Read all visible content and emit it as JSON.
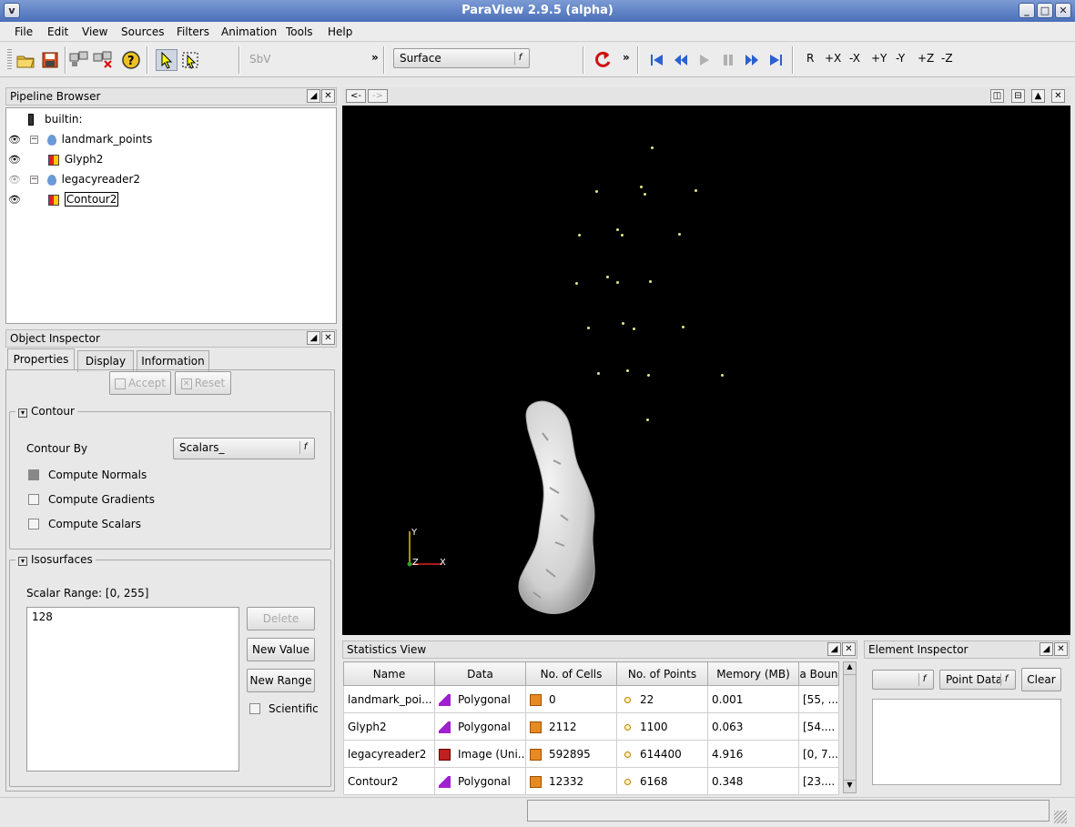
{
  "window": {
    "title": "ParaView 2.9.5 (alpha)"
  },
  "menu": [
    "File",
    "Edit",
    "View",
    "Sources",
    "Filters",
    "Animation",
    "Tools",
    "Help"
  ],
  "toolbar": {
    "calc_label": "SbV",
    "more_label": "»",
    "representation": "Surface",
    "camera_buttons": [
      "R",
      "+X",
      "-X",
      "+Y",
      "-Y",
      "+Z",
      "-Z"
    ]
  },
  "pipeline": {
    "title": "Pipeline Browser",
    "items": [
      {
        "label": "builtin:",
        "icon": "server-icon"
      },
      {
        "label": "landmark_points",
        "icon": "source-icon"
      },
      {
        "label": "Glyph2",
        "icon": "filter-icon"
      },
      {
        "label": "legacyreader2",
        "icon": "source-icon"
      },
      {
        "label": "Contour2",
        "icon": "filter-icon"
      }
    ]
  },
  "view_nav": {
    "back": "<-",
    "forward": "->"
  },
  "inspector": {
    "title": "Object Inspector",
    "tabs": [
      "Properties",
      "Display",
      "Information"
    ],
    "accept": "Accept",
    "reset": "Reset",
    "contour_group": "Contour",
    "contour_by_label": "Contour By",
    "contour_by_value": "Scalars_",
    "checks": [
      "Compute Normals",
      "Compute Gradients",
      "Compute Scalars"
    ],
    "iso_group": "Isosurfaces",
    "scalar_range": "Scalar Range: [0, 255]",
    "values": [
      "128"
    ],
    "delete": "Delete",
    "new_value": "New Value",
    "new_range": "New Range",
    "scientific": "Scientific"
  },
  "axes": {
    "y": "Y",
    "z": "Z",
    "x": "X"
  },
  "stats": {
    "title": "Statistics View",
    "columns": [
      "Name",
      "Data",
      "No. of Cells",
      "No. of Points",
      "Memory (MB)",
      "a Boun"
    ],
    "rows": [
      {
        "name": "landmark_poi...",
        "data": "Polygonal",
        "cells": "0",
        "points": "22",
        "memory": "0.001",
        "bounds": "[55, ..."
      },
      {
        "name": "Glyph2",
        "data": "Polygonal",
        "cells": "2112",
        "points": "1100",
        "memory": "0.063",
        "bounds": "[54...."
      },
      {
        "name": "legacyreader2",
        "data": "Image (Uni...",
        "cells": "592895",
        "points": "614400",
        "memory": "4.916",
        "bounds": "[0, 7..."
      },
      {
        "name": "Contour2",
        "data": "Polygonal",
        "cells": "12332",
        "points": "6168",
        "memory": "0.348",
        "bounds": "[23...."
      }
    ]
  },
  "element_inspector": {
    "title": "Element Inspector",
    "attribute": "Point Data",
    "clear": "Clear"
  }
}
